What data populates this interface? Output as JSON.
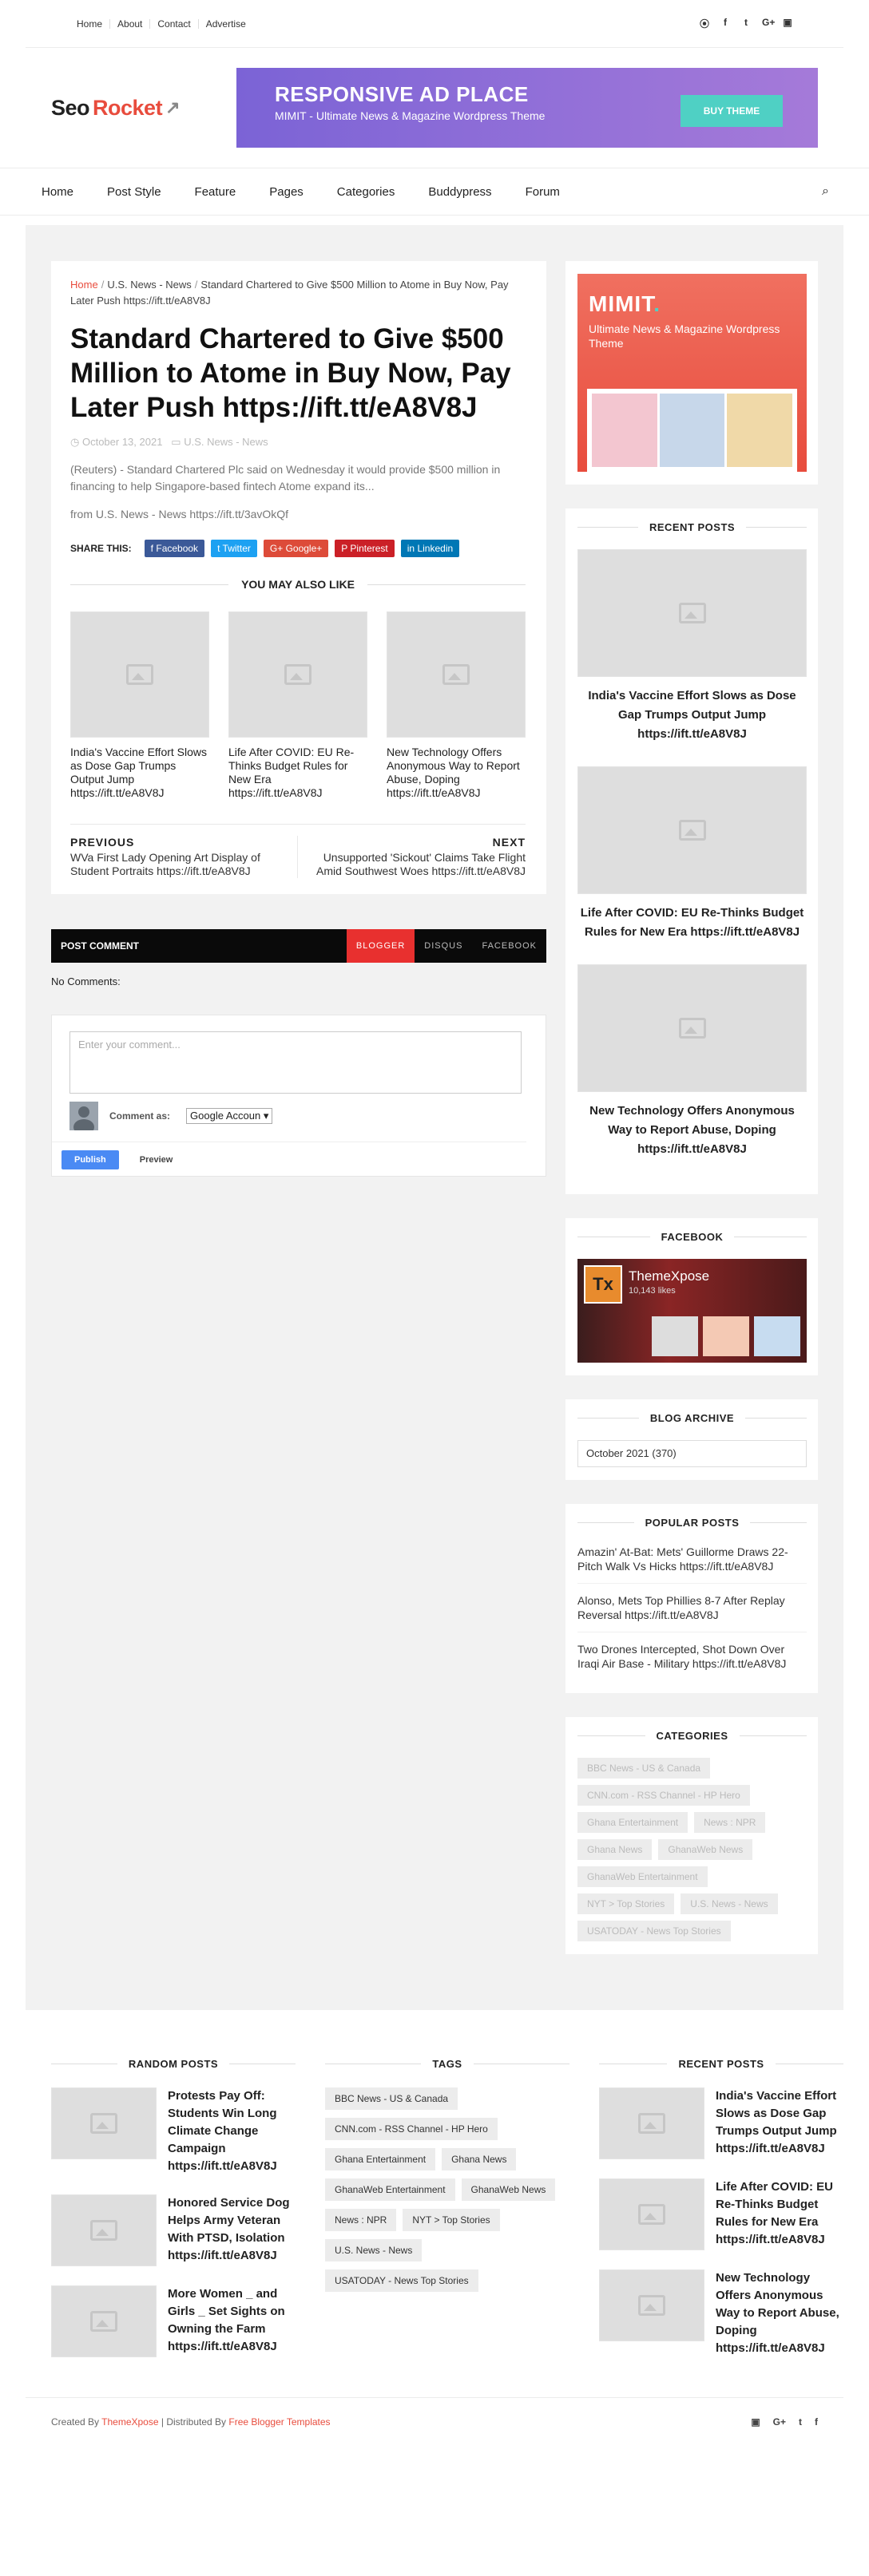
{
  "topbar": {
    "links": [
      "Home",
      "About",
      "Contact",
      "Advertise"
    ],
    "social_icons": [
      "rss-icon",
      "facebook-icon",
      "twitter-icon",
      "google-plus-icon",
      "instagram-icon"
    ]
  },
  "logo": {
    "part1": "Seo",
    "part2": "Rocket"
  },
  "ad": {
    "title": "RESPONSIVE AD PLACE",
    "subtitle": "MIMIT - Ultimate News & Magazine Wordpress Theme",
    "button": "BUY THEME"
  },
  "nav": {
    "items": [
      "Home",
      "Post Style",
      "Feature",
      "Pages",
      "Categories",
      "Buddypress",
      "Forum"
    ]
  },
  "post": {
    "breadcrumb_home": "Home",
    "breadcrumb_cat": "U.S. News - News",
    "breadcrumb_current": "Standard Chartered to Give $500 Million to Atome in Buy Now, Pay Later Push https://ift.tt/eA8V8J",
    "title": "Standard Chartered to Give $500 Million to Atome in Buy Now, Pay Later Push https://ift.tt/eA8V8J",
    "date": "October 13, 2021",
    "category": "U.S. News - News",
    "excerpt": "(Reuters) - Standard Chartered Plc said on Wednesday it would provide $500 million in financing to help Singapore-based fintech Atome expand its...",
    "from": "from U.S. News - News https://ift.tt/3avOkQf",
    "share_label": "SHARE THIS:",
    "share": [
      "Facebook",
      "Twitter",
      "Google+",
      "Pinterest",
      "Linkedin"
    ],
    "share_colors": [
      "#3b5998",
      "#1da1f2",
      "#dd4b39",
      "#cb2027",
      "#0077b5"
    ],
    "related_title": "YOU MAY ALSO LIKE",
    "related": [
      "India's Vaccine Effort Slows as Dose Gap Trumps Output Jump https://ift.tt/eA8V8J",
      "Life After COVID: EU Re-Thinks Budget Rules for New Era https://ift.tt/eA8V8J",
      "New Technology Offers Anonymous Way to Report Abuse, Doping https://ift.tt/eA8V8J"
    ],
    "prev_label": "PREVIOUS",
    "prev_title": "WVa First Lady Opening Art Display of Student Portraits https://ift.tt/eA8V8J",
    "next_label": "NEXT",
    "next_title": "Unsupported 'Sickout' Claims Take Flight Amid Southwest Woes https://ift.tt/eA8V8J"
  },
  "comments": {
    "bar_title": "POST COMMENT",
    "tabs": [
      "BLOGGER",
      "DISQUS",
      "FACEBOOK"
    ],
    "none": "No Comments:",
    "placeholder": "Enter your comment...",
    "comment_as": "Comment as:",
    "account": "Google Accoun",
    "publish": "Publish",
    "preview": "Preview"
  },
  "sidebar": {
    "mimit_title": "MIMIT",
    "mimit_sub": "Ultimate News & Magazine Wordpress Theme",
    "recent_title": "RECENT POSTS",
    "recent": [
      "India's Vaccine Effort Slows as Dose Gap Trumps Output Jump https://ift.tt/eA8V8J",
      "Life After COVID: EU Re-Thinks Budget Rules for New Era https://ift.tt/eA8V8J",
      "New Technology Offers Anonymous Way to Report Abuse, Doping https://ift.tt/eA8V8J"
    ],
    "facebook_title": "FACEBOOK",
    "fb_name": "ThemeXpose",
    "fb_likes": "10,143 likes",
    "archive_title": "BLOG ARCHIVE",
    "archive_value": "October 2021 (370)",
    "popular_title": "POPULAR POSTS",
    "popular": [
      "Amazin' At-Bat: Mets' Guillorme Draws 22-Pitch Walk Vs Hicks https://ift.tt/eA8V8J",
      "Alonso, Mets Top Phillies 8-7 After Replay Reversal https://ift.tt/eA8V8J",
      "Two Drones Intercepted, Shot Down Over Iraqi Air Base - Military https://ift.tt/eA8V8J"
    ],
    "categories_title": "CATEGORIES",
    "categories": [
      "BBC News - US & Canada",
      "CNN.com - RSS Channel - HP Hero",
      "Ghana Entertainment",
      "News : NPR",
      "Ghana News",
      "GhanaWeb News",
      "GhanaWeb Entertainment",
      "NYT > Top Stories",
      "U.S. News - News",
      "USATODAY - News Top Stories"
    ]
  },
  "footer": {
    "random_title": "RANDOM POSTS",
    "random": [
      "Protests Pay Off: Students Win Long Climate Change Campaign https://ift.tt/eA8V8J",
      "Honored Service Dog Helps Army Veteran With PTSD, Isolation https://ift.tt/eA8V8J",
      "More Women _ and Girls _ Set Sights on Owning the Farm https://ift.tt/eA8V8J"
    ],
    "tags_title": "TAGS",
    "tags": [
      "BBC News - US & Canada",
      "CNN.com - RSS Channel - HP Hero",
      "Ghana Entertainment",
      "Ghana News",
      "GhanaWeb Entertainment",
      "GhanaWeb News",
      "News : NPR",
      "NYT > Top Stories",
      "U.S. News - News",
      "USATODAY - News Top Stories"
    ],
    "recent_title": "RECENT POSTS",
    "recent": [
      "India's Vaccine Effort Slows as Dose Gap Trumps Output Jump https://ift.tt/eA8V8J",
      "Life After COVID: EU Re-Thinks Budget Rules for New Era https://ift.tt/eA8V8J",
      "New Technology Offers Anonymous Way to Report Abuse, Doping https://ift.tt/eA8V8J"
    ],
    "created_by": "Created By",
    "created_name": "ThemeXpose",
    "distributed_by": "| Distributed By",
    "distributed_name": "Free Blogger Templates",
    "social_icons": [
      "instagram-icon",
      "google-plus-icon",
      "twitter-icon",
      "facebook-icon"
    ]
  }
}
